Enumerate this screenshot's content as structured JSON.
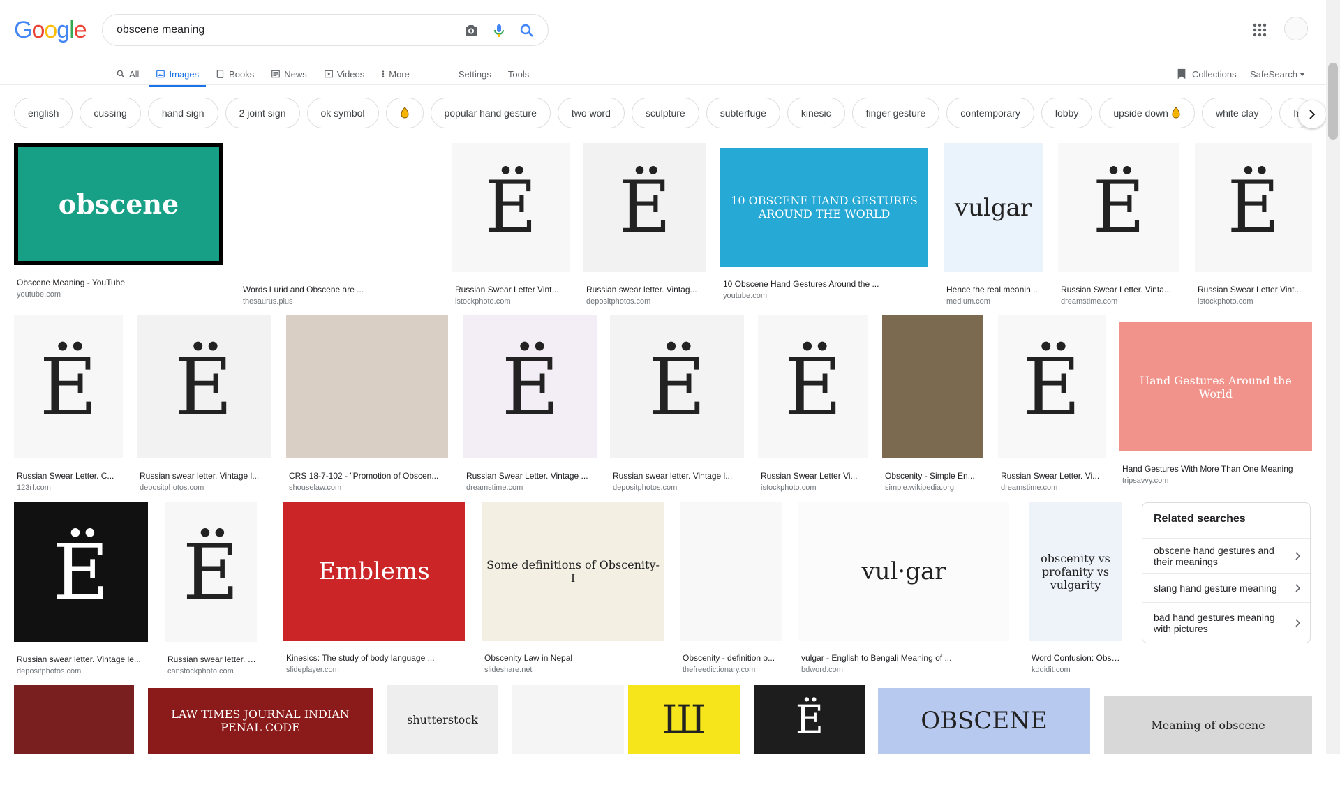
{
  "search": {
    "query": "obscene meaning"
  },
  "logo_letters": [
    {
      "ch": "G",
      "color": "#4285f4"
    },
    {
      "ch": "o",
      "color": "#ea4335"
    },
    {
      "ch": "o",
      "color": "#fbbc05"
    },
    {
      "ch": "g",
      "color": "#4285f4"
    },
    {
      "ch": "l",
      "color": "#34a853"
    },
    {
      "ch": "e",
      "color": "#ea4335"
    }
  ],
  "tabs": {
    "all": "All",
    "images": "Images",
    "books": "Books",
    "news": "News",
    "videos": "Videos",
    "more": "More",
    "settings": "Settings",
    "tools": "Tools"
  },
  "right_tools": {
    "collections": "Collections",
    "safesearch": "SafeSearch"
  },
  "chips": [
    "english",
    "cussing",
    "hand sign",
    "2 joint sign",
    "ok symbol",
    "",
    "popular hand gesture",
    "two word",
    "sculpture",
    "subterfuge",
    "kinesic",
    "finger gesture",
    "contemporary",
    "lobby",
    "upside down",
    "white clay",
    "h"
  ],
  "results": [
    {
      "title": "Obscene Meaning - YouTube",
      "source": "youtube.com",
      "thumb_text": "obscene"
    },
    {
      "title": "Words Lurid and Obscene are ...",
      "source": "thesaurus.plus",
      "thumb_text": ""
    },
    {
      "title": "Russian Swear Letter Vint...",
      "source": "istockphoto.com",
      "thumb_text": "Ё"
    },
    {
      "title": "Russian swear letter. Vintag...",
      "source": "depositphotos.com",
      "thumb_text": "Ё"
    },
    {
      "title": "10 Obscene Hand Gestures Around the ...",
      "source": "youtube.com",
      "thumb_text": "10 OBSCENE HAND GESTURES AROUND THE WORLD"
    },
    {
      "title": "Hence the real meanin...",
      "source": "medium.com",
      "thumb_text": "vulgar"
    },
    {
      "title": "Russian Swear Letter. Vinta...",
      "source": "dreamstime.com",
      "thumb_text": "Ё"
    },
    {
      "title": "Russian Swear Letter Vint...",
      "source": "istockphoto.com",
      "thumb_text": "Ё"
    },
    {
      "title": "Russian Swear Letter. C...",
      "source": "123rf.com",
      "thumb_text": "Ё"
    },
    {
      "title": "Russian swear letter. Vintage l...",
      "source": "depositphotos.com",
      "thumb_text": "Ё"
    },
    {
      "title": "CRS 18-7-102 - \"Promotion of Obscen...",
      "source": "shouselaw.com",
      "thumb_text": ""
    },
    {
      "title": "Russian Swear Letter. Vintage ...",
      "source": "dreamstime.com",
      "thumb_text": "Ё"
    },
    {
      "title": "Russian swear letter. Vintage l...",
      "source": "depositphotos.com",
      "thumb_text": "Ё"
    },
    {
      "title": "Russian Swear Letter Vi...",
      "source": "istockphoto.com",
      "thumb_text": "Ё"
    },
    {
      "title": "Obscenity - Simple En...",
      "source": "simple.wikipedia.org",
      "thumb_text": ""
    },
    {
      "title": "Russian Swear Letter. Vi...",
      "source": "dreamstime.com",
      "thumb_text": "Ё"
    },
    {
      "title": "Hand Gestures With More Than One Meaning",
      "source": "tripsavvy.com",
      "thumb_text": "Hand Gestures Around the World"
    },
    {
      "title": "Russian swear letter. Vintage le...",
      "source": "depositphotos.com",
      "thumb_text": "Ё"
    },
    {
      "title": "Russian swear letter. vi...",
      "source": "canstockphoto.com",
      "thumb_text": "Ё"
    },
    {
      "title": "Kinesics: The study of body language ...",
      "source": "slideplayer.com",
      "thumb_text": "Emblems"
    },
    {
      "title": "Obscenity Law in Nepal",
      "source": "slideshare.net",
      "thumb_text": "Some definitions of Obscenity-I"
    },
    {
      "title": "Obscenity - definition o...",
      "source": "thefreedictionary.com",
      "thumb_text": ""
    },
    {
      "title": "vulgar - English to Bengali Meaning of ...",
      "source": "bdword.com",
      "thumb_text": "vul·gar"
    },
    {
      "title": "Word Confusion: Obsc...",
      "source": "kddidit.com",
      "thumb_text": "obscenity vs profanity vs vulgarity"
    },
    {
      "title": "",
      "source": "",
      "thumb_text": ""
    },
    {
      "title": "",
      "source": "",
      "thumb_text": "LAW TIMES JOURNAL INDIAN PENAL CODE"
    },
    {
      "title": "",
      "source": "",
      "thumb_text": "shutterstock"
    },
    {
      "title": "",
      "source": "",
      "thumb_text": ""
    },
    {
      "title": "",
      "source": "",
      "thumb_text": "Ш"
    },
    {
      "title": "",
      "source": "",
      "thumb_text": "Ё"
    },
    {
      "title": "",
      "source": "",
      "thumb_text": "OBSCENE"
    },
    {
      "title": "",
      "source": "",
      "thumb_text": "Meaning of obscene"
    }
  ],
  "related": {
    "heading": "Related searches",
    "items": [
      "obscene hand gestures and their meanings",
      "slang hand gesture meaning",
      "bad hand gestures meaning with pictures"
    ]
  },
  "colors": {
    "accent": "#1a73e8",
    "chip_border": "#dadce0"
  }
}
